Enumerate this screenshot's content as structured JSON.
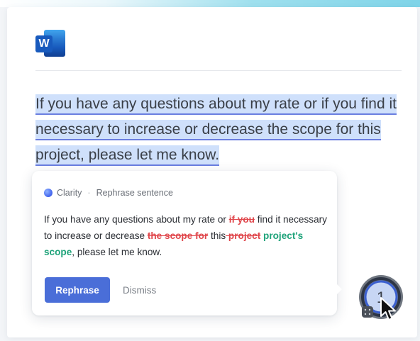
{
  "app": {
    "name": "Word",
    "logo_letter": "W",
    "icon": "word-icon"
  },
  "document": {
    "selected_text": "If you have any questions about my rate or if you find it necessary to increase or decrease the scope for this project, please let me know."
  },
  "popup": {
    "brand": "Clarity",
    "separator": "·",
    "action": "Rephrase sentence",
    "suggestion": {
      "t1": "If you have any questions about my rate or ",
      "del1": "if you",
      "t2": " find it necessary to increase or decrease ",
      "del2": "the scope for",
      "t3": " this",
      "del3": " project",
      "t4": " ",
      "ins1": "project's scope",
      "t5": ", please let me know."
    },
    "rephrase_label": "Rephrase",
    "dismiss_label": "Dismiss"
  },
  "assistant": {
    "count": "1",
    "icon": "clarity-assistant-icon"
  },
  "colors": {
    "accent": "#4a6ed8",
    "highlight": "#cfe0fb",
    "deletion": "#e0474c",
    "insertion": "#1fa37a"
  }
}
